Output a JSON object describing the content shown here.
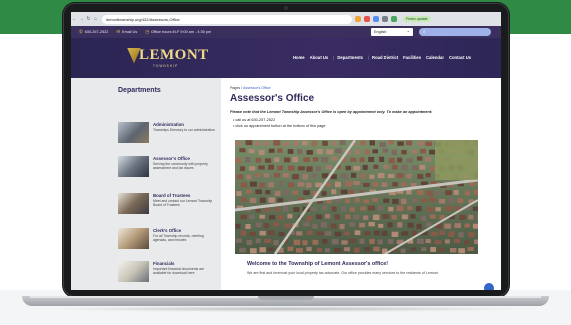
{
  "browser": {
    "url": "lemonttownship.org/432/Assessors-Office",
    "finish_update": "Finish update"
  },
  "topbar": {
    "phone": "630-257-2522",
    "email": "Email Us",
    "hours": "Office hours M-F 9:00 am - 4:30 pm",
    "language": "English"
  },
  "logo": {
    "main": "LEMONT",
    "sub": "TOWNSHIP"
  },
  "nav": {
    "items": [
      "Home",
      "About Us",
      "Departments",
      "Road District",
      "Facilities",
      "Calendar",
      "Contact Us"
    ]
  },
  "sidebar": {
    "title": "Departments",
    "items": [
      {
        "name": "Administration",
        "desc": "Townships Directory to our administration"
      },
      {
        "name": "Assessor's Office",
        "desc": "Serving the community with property assessment and tax issues"
      },
      {
        "name": "Board of Trustees",
        "desc": "Meet and contact our Lemont Township Board of Trustees"
      },
      {
        "name": "Clerk's Office",
        "desc": "For all Township records, meeting agendas, and minutes"
      },
      {
        "name": "Financials",
        "desc": "Important financial documents are available for download here"
      }
    ]
  },
  "main": {
    "breadcrumb_pages": "Pages",
    "breadcrumb_sep": "/",
    "breadcrumb_current": "Assessor's Office",
    "title": "Assessor's Office",
    "notice": "Please note that the Lemont Township Assessor's Office is open by appointment only.  To make an appointment:",
    "bullets": [
      "call us at 630-257-2522",
      "click on appointment button at the bottom of this page"
    ],
    "welcome": "Welcome to the Township of Lemont Assessor's office!",
    "paragraph": "We are first and foremost your local property tax advocate. Our office provides many services to the residents of Lemont"
  }
}
